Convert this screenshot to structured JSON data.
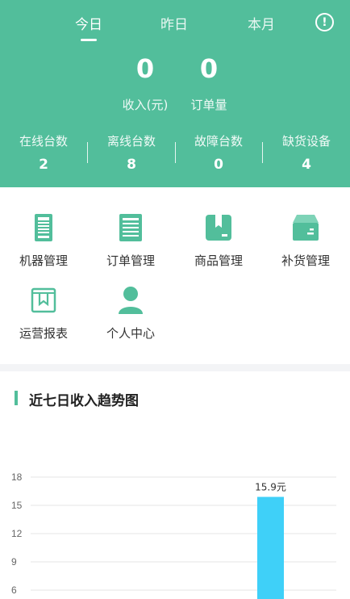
{
  "header": {
    "tabs": [
      {
        "label": "今日"
      },
      {
        "label": "昨日"
      },
      {
        "label": "本月"
      }
    ],
    "info_icon": "info-circle-icon",
    "revenue": {
      "value": "0",
      "label": "收入(元)"
    },
    "orders": {
      "value": "0",
      "label": "订单量"
    },
    "stats": [
      {
        "label": "在线台数",
        "value": "2"
      },
      {
        "label": "离线台数",
        "value": "8"
      },
      {
        "label": "故障台数",
        "value": "0"
      },
      {
        "label": "缺货设备",
        "value": "4"
      }
    ],
    "background": "#52be9b"
  },
  "menu": {
    "items": [
      {
        "label": "机器管理",
        "icon": "vending-machine-icon"
      },
      {
        "label": "订单管理",
        "icon": "order-list-icon"
      },
      {
        "label": "商品管理",
        "icon": "product-box-icon"
      },
      {
        "label": "补货管理",
        "icon": "restock-box-icon"
      },
      {
        "label": "运营报表",
        "icon": "report-icon"
      },
      {
        "label": "个人中心",
        "icon": "user-icon"
      }
    ],
    "accent": "#52be9b"
  },
  "chart_section": {
    "title": "近七日收入趋势图"
  },
  "chart_data": {
    "type": "bar",
    "y_ticks": [
      6,
      9,
      12,
      15,
      18
    ],
    "ylim": [
      0,
      18
    ],
    "bars": [
      {
        "value": 15.9,
        "label": "15.9元"
      }
    ],
    "bar_color": "#3fd0f8",
    "grid": true
  }
}
